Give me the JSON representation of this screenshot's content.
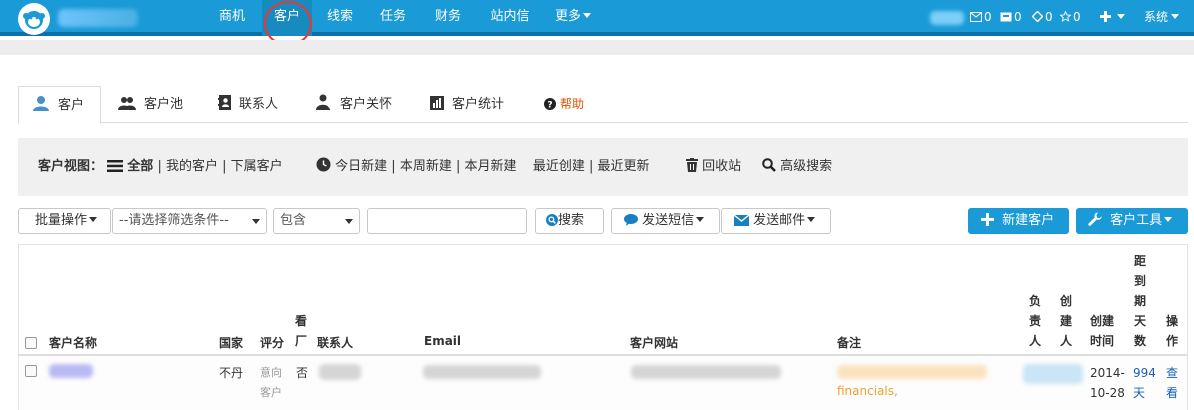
{
  "topnav": {
    "items": [
      "商机",
      "客户",
      "线索",
      "任务",
      "财务",
      "站内信",
      "更多"
    ],
    "active": "客户",
    "stats": {
      "mail": "0",
      "inbox": "0",
      "tasks": "0",
      "favorites": "0"
    },
    "system_label": "系统"
  },
  "tabs": [
    {
      "label": "客户",
      "icon": "user-icon"
    },
    {
      "label": "客户池",
      "icon": "users-icon"
    },
    {
      "label": "联系人",
      "icon": "address-book-icon"
    },
    {
      "label": "客户关怀",
      "icon": "user-care-icon"
    },
    {
      "label": "客户统计",
      "icon": "bar-chart-icon"
    },
    {
      "label": "帮助",
      "icon": "question-icon"
    }
  ],
  "viewbar": {
    "prefix": "客户视图：",
    "all": "全部",
    "mine": "我的客户",
    "sub": "下属客户",
    "today_new": "今日新建",
    "week_new": "本周新建",
    "month_new": "本月新建",
    "recent_created": "最近创建",
    "recent_updated": "最近更新",
    "recycle": "回收站",
    "advanced_search": "高级搜索",
    "sep": "|"
  },
  "toolbar": {
    "batch": "批量操作",
    "filter_placeholder": "--请选择筛选条件--",
    "operator": "包含",
    "search_value": "",
    "search": "搜索",
    "send_sms": "发送短信",
    "send_email": "发送邮件",
    "new_customer": "新建客户",
    "customer_tools": "客户工具"
  },
  "table": {
    "headers": {
      "name": "客户名称",
      "country": "国家",
      "rating": "评分",
      "factory_visit": [
        "看",
        "厂"
      ],
      "contact": "联系人",
      "email": "Email",
      "website": "客户网站",
      "remark": "备注",
      "owner": [
        "负",
        "责",
        "人"
      ],
      "creator": [
        "创",
        "建",
        "人"
      ],
      "created_time": [
        "创建",
        "时间"
      ],
      "days_to_expiry": [
        "距",
        "到",
        "期",
        "天",
        "数"
      ],
      "actions": [
        "操",
        "作"
      ]
    },
    "rows": [
      {
        "country": "不丹",
        "rating": [
          "意向",
          "客户"
        ],
        "factory_visit": "否",
        "remark": "financials,",
        "created_time": [
          "2014-",
          "10-28"
        ],
        "days": [
          "994",
          "天"
        ],
        "actions": [
          "查",
          "看"
        ]
      }
    ]
  }
}
